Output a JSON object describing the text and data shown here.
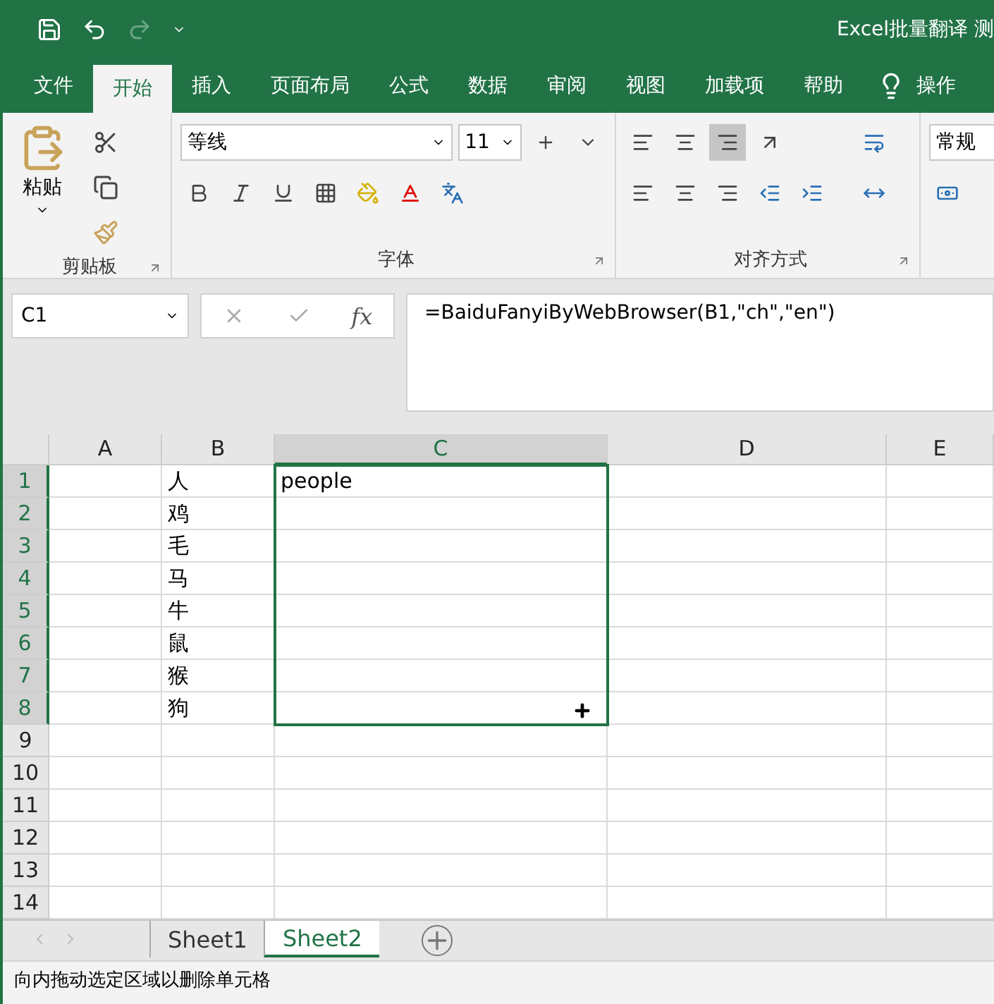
{
  "title_bar": {
    "title": "Excel批量翻译 测"
  },
  "ribbon_tabs": [
    {
      "label": "文件",
      "selected": false
    },
    {
      "label": "开始",
      "selected": true
    },
    {
      "label": "插入",
      "selected": false
    },
    {
      "label": "页面布局",
      "selected": false
    },
    {
      "label": "公式",
      "selected": false
    },
    {
      "label": "数据",
      "selected": false
    },
    {
      "label": "审阅",
      "selected": false
    },
    {
      "label": "视图",
      "selected": false
    },
    {
      "label": "加载项",
      "selected": false
    },
    {
      "label": "帮助",
      "selected": false
    }
  ],
  "tell_me": "操作",
  "ribbon": {
    "paste_label": "粘贴",
    "clipboard_group": "剪贴板",
    "font_name": "等线",
    "font_size": "11",
    "font_group": "字体",
    "alignment_group": "对齐方式",
    "vertical_align": [
      {
        "kind": "top",
        "selected": false
      },
      {
        "kind": "middle",
        "selected": false
      },
      {
        "kind": "bottom",
        "selected": true
      }
    ],
    "number_format": "常规"
  },
  "name_box": "C1",
  "function_button": "fx",
  "formula": "=BaiduFanyiByWebBrowser(B1,\"ch\",\"en\")",
  "columns": [
    {
      "label": "A",
      "selected": false
    },
    {
      "label": "B",
      "selected": false
    },
    {
      "label": "C",
      "selected": true
    },
    {
      "label": "D",
      "selected": false
    },
    {
      "label": "E",
      "selected": false
    }
  ],
  "rows": [
    {
      "label": "1",
      "selected": true,
      "cells": [
        "",
        "人",
        "people",
        "",
        ""
      ]
    },
    {
      "label": "2",
      "selected": true,
      "cells": [
        "",
        "鸡",
        "",
        "",
        ""
      ]
    },
    {
      "label": "3",
      "selected": true,
      "cells": [
        "",
        "毛",
        "",
        "",
        ""
      ]
    },
    {
      "label": "4",
      "selected": true,
      "cells": [
        "",
        "马",
        "",
        "",
        ""
      ]
    },
    {
      "label": "5",
      "selected": true,
      "cells": [
        "",
        "牛",
        "",
        "",
        ""
      ]
    },
    {
      "label": "6",
      "selected": true,
      "cells": [
        "",
        "鼠",
        "",
        "",
        ""
      ]
    },
    {
      "label": "7",
      "selected": true,
      "cells": [
        "",
        "猴",
        "",
        "",
        ""
      ]
    },
    {
      "label": "8",
      "selected": true,
      "cells": [
        "",
        "狗",
        "",
        "",
        ""
      ]
    },
    {
      "label": "9",
      "selected": false,
      "cells": [
        "",
        "",
        "",
        "",
        ""
      ]
    },
    {
      "label": "10",
      "selected": false,
      "cells": [
        "",
        "",
        "",
        "",
        ""
      ]
    },
    {
      "label": "11",
      "selected": false,
      "cells": [
        "",
        "",
        "",
        "",
        ""
      ]
    },
    {
      "label": "12",
      "selected": false,
      "cells": [
        "",
        "",
        "",
        "",
        ""
      ]
    },
    {
      "label": "13",
      "selected": false,
      "cells": [
        "",
        "",
        "",
        "",
        ""
      ]
    },
    {
      "label": "14",
      "selected": false,
      "cells": [
        "",
        "",
        "",
        "",
        ""
      ]
    }
  ],
  "sheets": [
    {
      "label": "Sheet1",
      "selected": false
    },
    {
      "label": "Sheet2",
      "selected": true
    }
  ],
  "status_bar": "向内拖动选定区域以删除单元格"
}
